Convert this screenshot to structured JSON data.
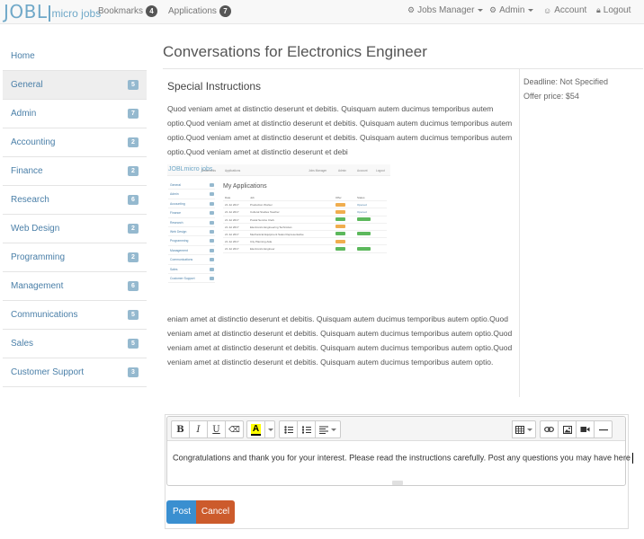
{
  "topnav": {
    "logo_main": "JOBL",
    "logo_sub": "micro jobs",
    "bookmarks": {
      "label": "Bookmarks",
      "count": "4"
    },
    "applications": {
      "label": "Applications",
      "count": "7"
    },
    "jobs_manager": "Jobs Manager",
    "admin": "Admin",
    "account": "Account",
    "logout": "Logout"
  },
  "sidebar": {
    "items": [
      {
        "label": "Home",
        "count": ""
      },
      {
        "label": "General",
        "count": "5"
      },
      {
        "label": "Admin",
        "count": "7"
      },
      {
        "label": "Accounting",
        "count": "2"
      },
      {
        "label": "Finance",
        "count": "2"
      },
      {
        "label": "Research",
        "count": "6"
      },
      {
        "label": "Web Design",
        "count": "2"
      },
      {
        "label": "Programming",
        "count": "2"
      },
      {
        "label": "Management",
        "count": "6"
      },
      {
        "label": "Communications",
        "count": "5"
      },
      {
        "label": "Sales",
        "count": "5"
      },
      {
        "label": "Customer Support",
        "count": "3"
      }
    ]
  },
  "main": {
    "title": "Conversations for Electronics Engineer",
    "section_heading": "Special Instructions",
    "para1": "Quod veniam amet at distinctio deserunt et debitis. Quisquam autem ducimus temporibus autem optio.Quod veniam amet at distinctio deserunt et debitis. Quisquam autem ducimus temporibus autem optio.Quod veniam amet at distinctio deserunt et debitis. Quisquam autem ducimus temporibus autem optio.Quod veniam amet at distinctio deserunt et debi",
    "para2": "eniam amet at distinctio deserunt et debitis. Quisquam autem ducimus temporibus autem optio.Quod veniam amet at distinctio deserunt et debitis. Quisquam autem ducimus temporibus autem optio.Quod veniam amet at distinctio deserunt et debitis. Quisquam autem ducimus temporibus autem optio.Quod veniam amet at distinctio deserunt et debitis. Quisquam autem ducimus temporibus autem optio.",
    "deadline": "Deadline: Not Specified",
    "offer_price": "Offer price: $54"
  },
  "thumbnail": {
    "logo": "JOBLmicro jobs",
    "title": "My Applications",
    "columns": [
      "Date",
      "Job",
      "Offer",
      "Status"
    ],
    "side_items": [
      "General",
      "Admin",
      "Accounting",
      "Finance",
      "Research",
      "Web Design",
      "Programming",
      "Management",
      "Communications",
      "Sales",
      "Customer Support"
    ],
    "rows": [
      {
        "date": "21 Jul 2017",
        "job": "Production Worker",
        "offer": "warn",
        "status": "Opened"
      },
      {
        "date": "21 Jul 2017",
        "job": "Cultural Studies Teacher",
        "offer": "warn",
        "status": "Opened"
      },
      {
        "date": "21 Jul 2017",
        "job": "Postal Service Clerk",
        "offer": "succ",
        "status": "badge"
      },
      {
        "date": "21 Jul 2017",
        "job": "Electronics Engineering Technician",
        "offer": "warn",
        "status": ""
      },
      {
        "date": "21 Jul 2017",
        "job": "Mechanical Equipment Sales Representative",
        "offer": "succ",
        "status": "badge"
      },
      {
        "date": "21 Jul 2017",
        "job": "City Planning Aide",
        "offer": "warn",
        "status": ""
      },
      {
        "date": "21 Jul 2017",
        "job": "Electronics Engineer",
        "offer": "succ",
        "status": "badge"
      }
    ]
  },
  "editor": {
    "text": "Congratulations and thank you for your interest. Please read the instructions carefully. Post any questions you may have here",
    "toolbar": {
      "bold": "B",
      "italic": "I",
      "underline": "U",
      "eraser": "⌫",
      "color": "A"
    }
  },
  "buttons": {
    "post": "Post",
    "cancel": "Cancel"
  }
}
